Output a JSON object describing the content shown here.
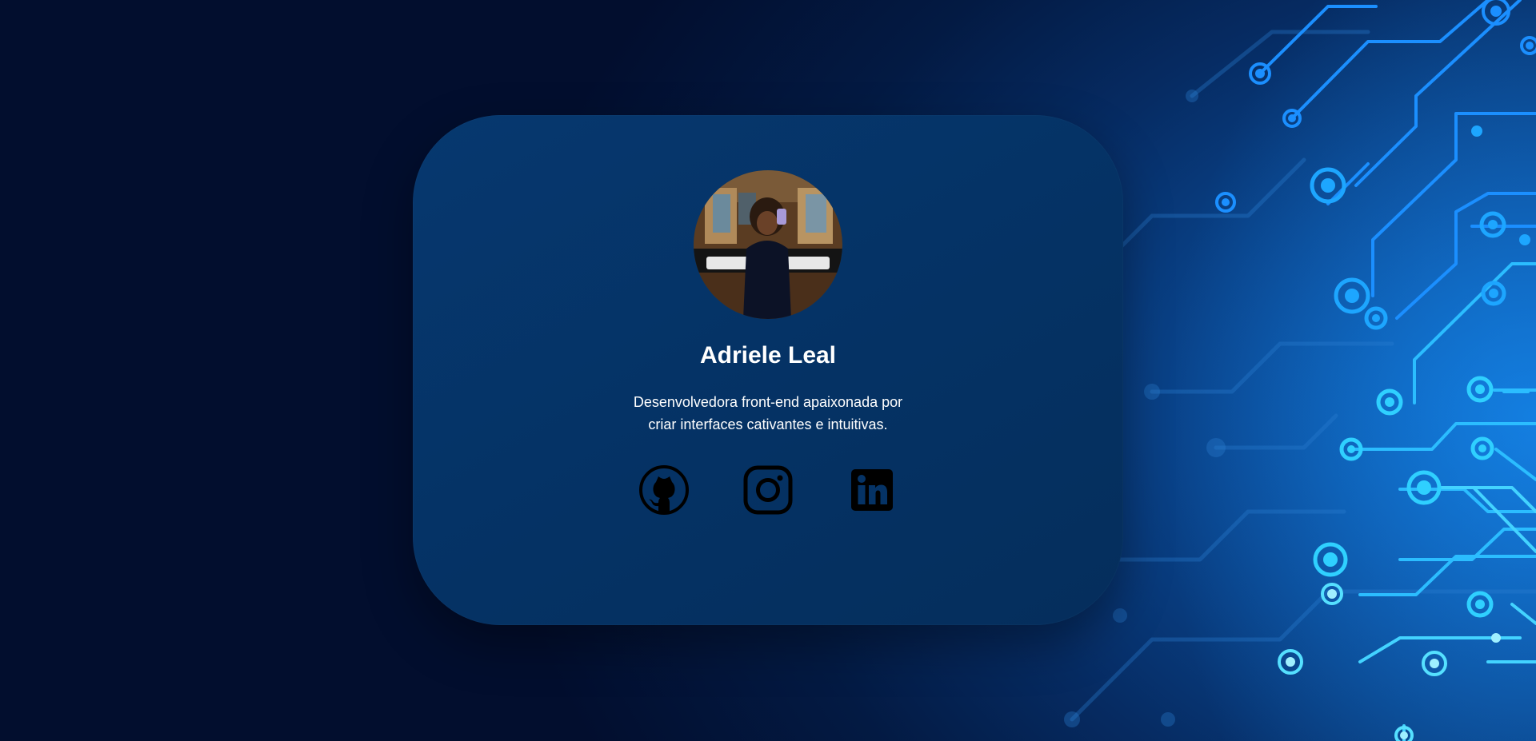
{
  "profile": {
    "name": "Adriele Leal",
    "bio_line1": "Desenvolvedora front-end apaixonada por",
    "bio_line2": "criar interfaces cativantes e intuitivas."
  },
  "social_links": [
    {
      "icon": "github-icon"
    },
    {
      "icon": "instagram-icon"
    },
    {
      "icon": "linkedin-icon"
    }
  ],
  "colors": {
    "background_dark": "#020e2e",
    "card": "#053366",
    "circuit_glow": "#39c8ff",
    "text": "#ffffff",
    "icon": "#000000"
  }
}
